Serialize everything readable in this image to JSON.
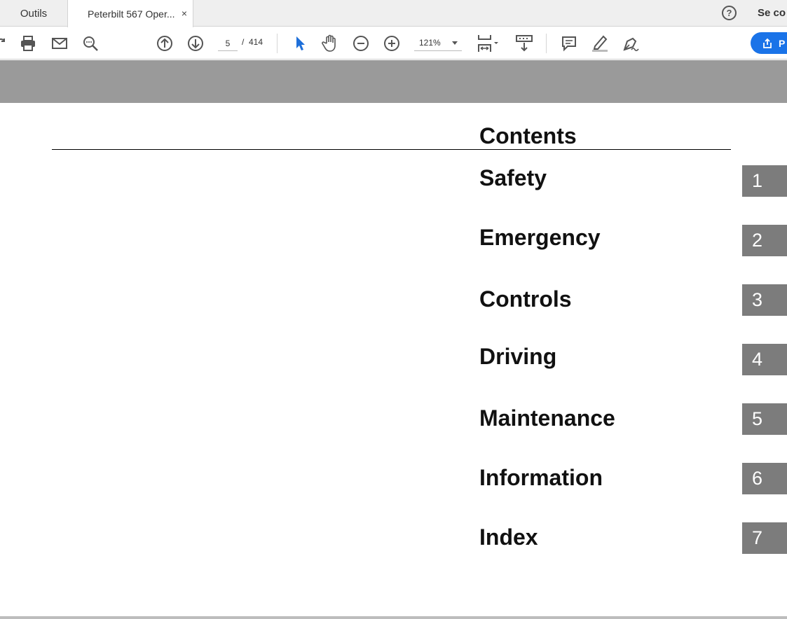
{
  "tabs": {
    "tools_label": "Outils",
    "document_label": "Peterbilt 567 Oper...",
    "close_symbol": "×"
  },
  "header_right": {
    "help_symbol": "?",
    "signin_label": "Se co"
  },
  "toolbar": {
    "page_current": "5",
    "page_separator": "/",
    "page_total": "414",
    "zoom_value": "121%",
    "share_label": "P",
    "icons": [
      "share-back-icon",
      "print-icon",
      "email-icon",
      "search-icon",
      "page-up-icon",
      "page-down-icon",
      "select-cursor-icon",
      "hand-tool-icon",
      "zoom-out-icon",
      "zoom-in-icon",
      "fit-page-icon",
      "scroll-mode-icon",
      "comment-icon",
      "highlight-icon",
      "sign-icon"
    ],
    "accent_color": "#1a73e8",
    "cursor_color": "#1e6fd9"
  },
  "document": {
    "contents_title": "Contents",
    "entries": [
      {
        "label": "Safety",
        "number": "1"
      },
      {
        "label": "Emergency",
        "number": "2"
      },
      {
        "label": "Controls",
        "number": "3"
      },
      {
        "label": "Driving",
        "number": "4"
      },
      {
        "label": "Maintenance",
        "number": "5"
      },
      {
        "label": "Information",
        "number": "6"
      },
      {
        "label": "Index",
        "number": "7"
      }
    ],
    "tab_color": "#7c7c7c",
    "band_color": "#9a9a9a"
  }
}
